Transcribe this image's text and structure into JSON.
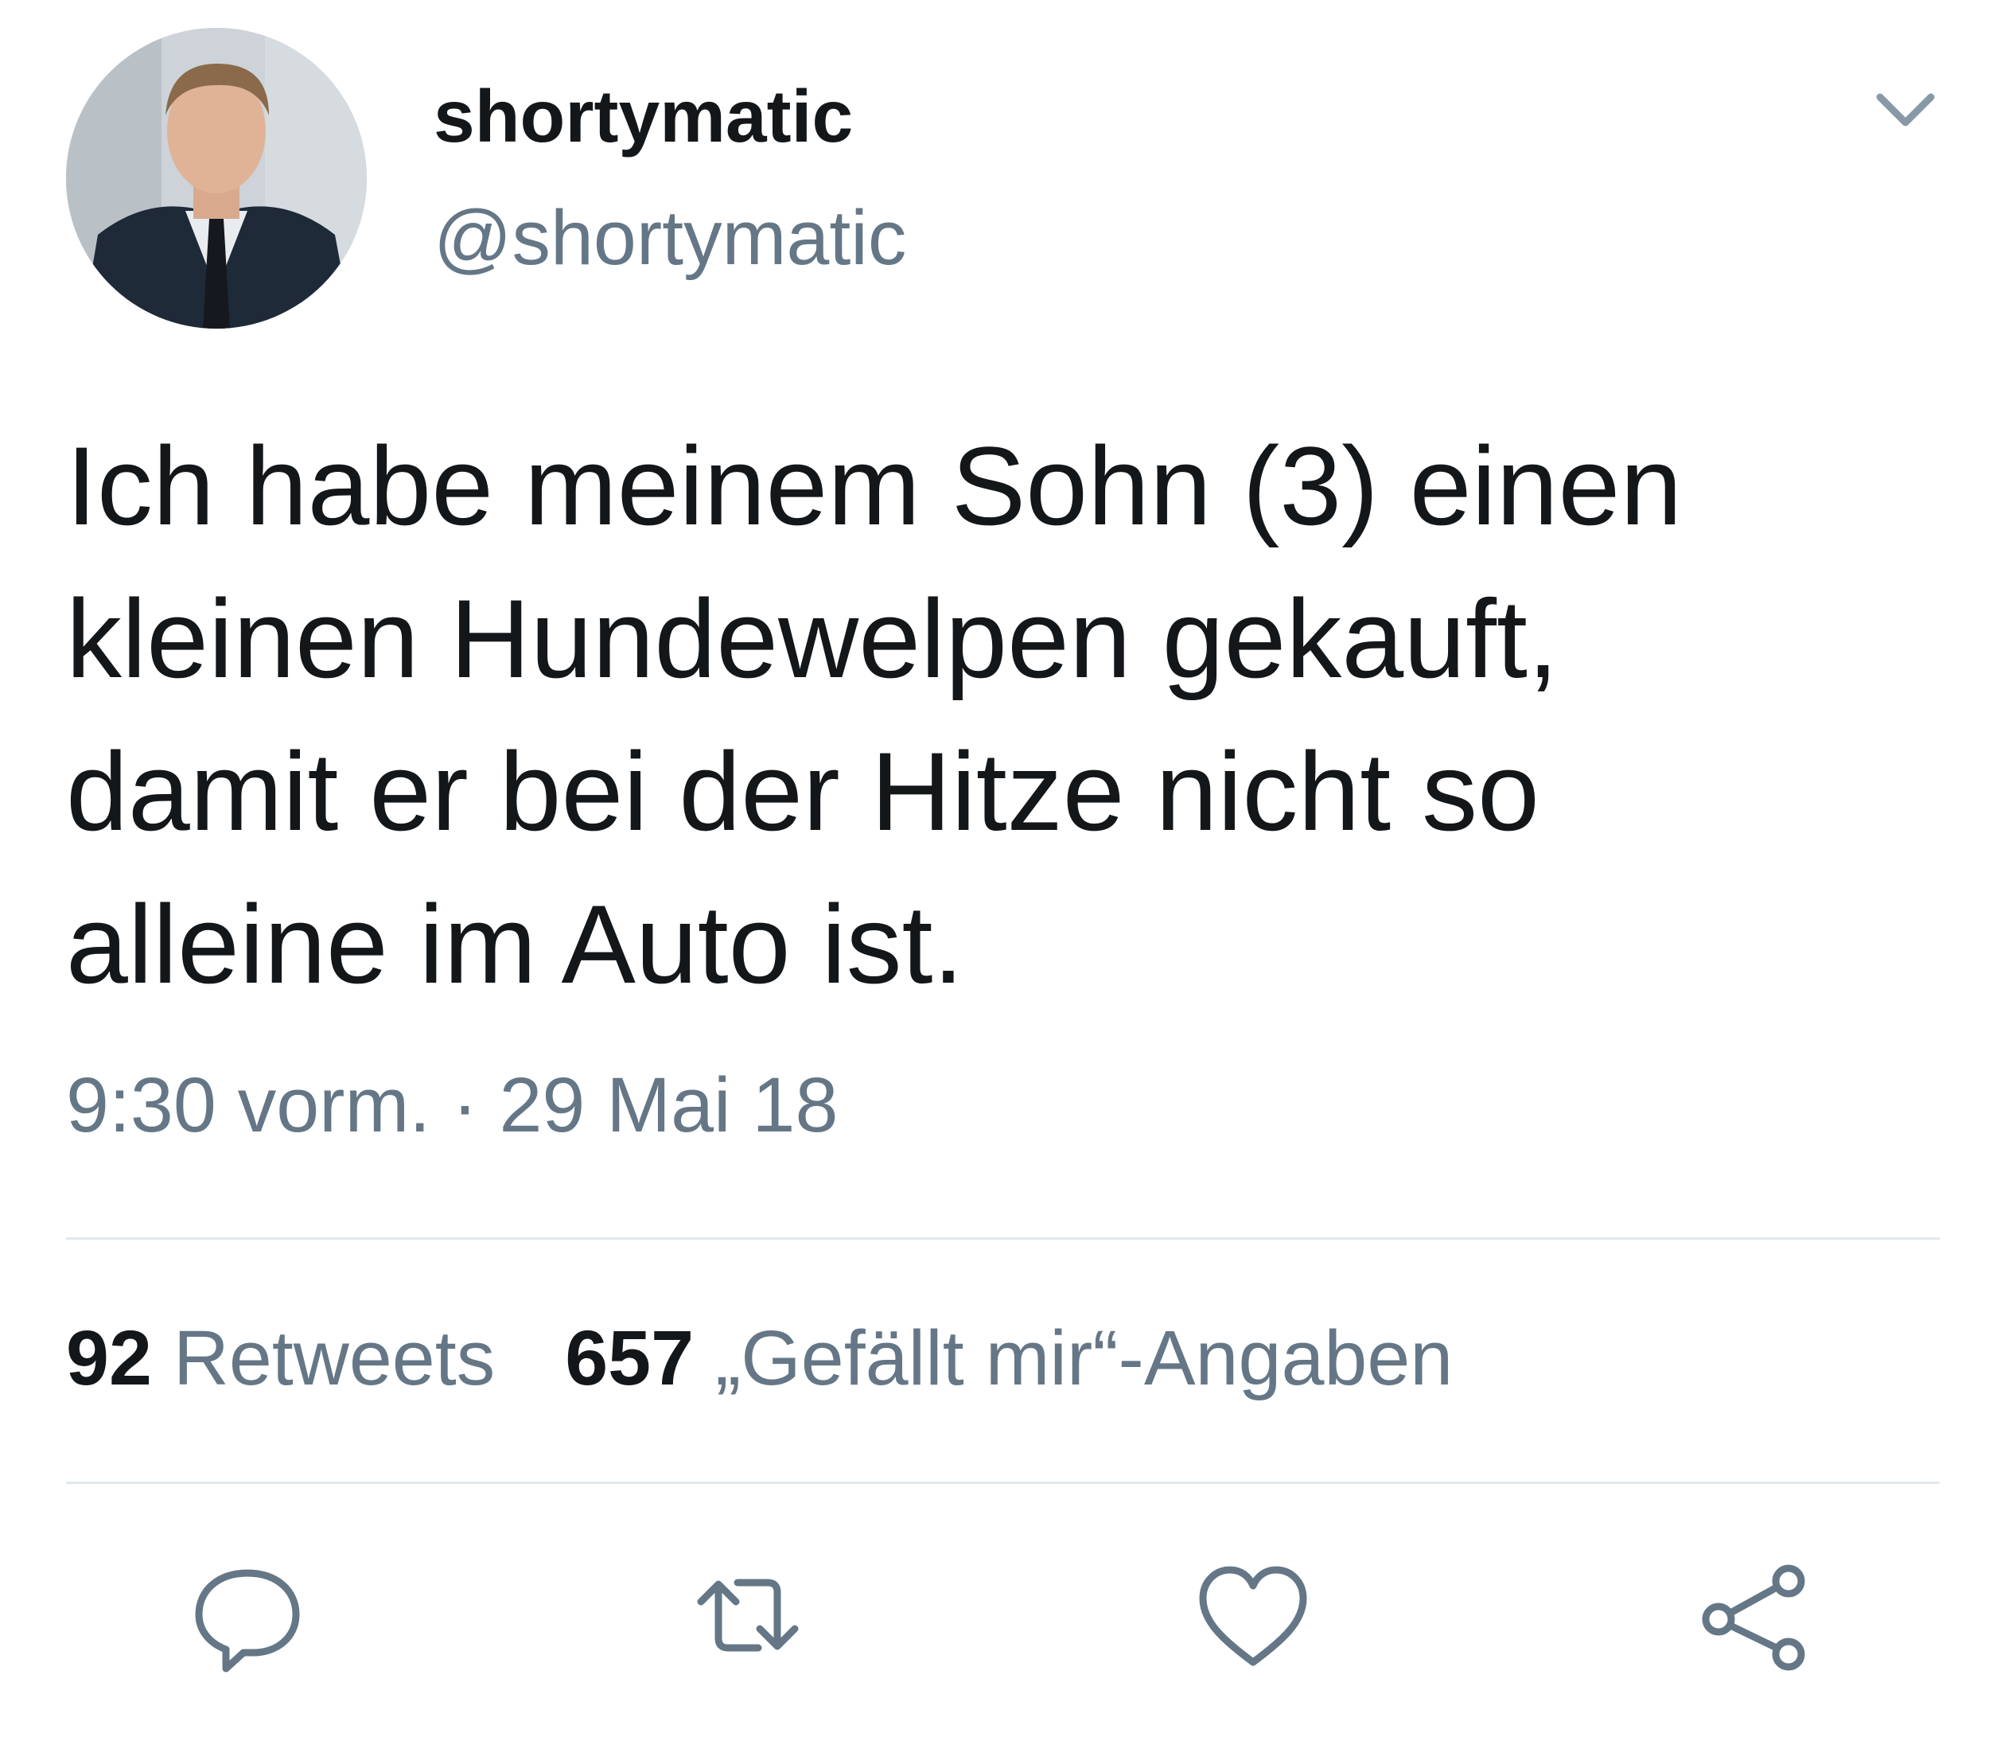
{
  "user": {
    "display_name": "shortymatic",
    "handle": "@shortymatic"
  },
  "tweet": {
    "text": "Ich habe meinem Sohn (3) einen\nkleinen Hundewelpen gekauft,\ndamit er bei der Hitze nicht so\nalleine im Auto ist.",
    "timestamp": "9:30 vorm. · 29 Mai 18"
  },
  "stats": {
    "retweets_count": "92",
    "retweets_label": "Retweets",
    "likes_count": "657",
    "likes_label": "„Gefällt mir“-Angaben"
  },
  "icons": {
    "reply": "reply-icon",
    "retweet": "retweet-icon",
    "like": "heart-icon",
    "share": "share-icon",
    "menu": "chevron-down-icon"
  },
  "colors": {
    "text_primary": "#14171a",
    "text_secondary": "#657786",
    "divider": "#e1e8ed"
  }
}
